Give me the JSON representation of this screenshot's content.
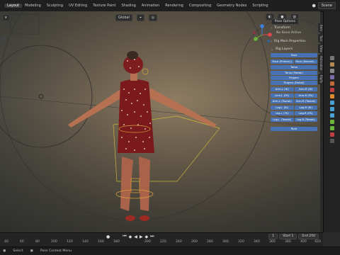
{
  "workspaces": [
    "Layout",
    "Modeling",
    "Sculpting",
    "UV Editing",
    "Texture Paint",
    "Shading",
    "Animation",
    "Rendering",
    "Compositing",
    "Geometry Nodes",
    "Scripting"
  ],
  "active_workspace": "Layout",
  "scene_name": "Scene",
  "header": {
    "transform_orientation": "Global",
    "pose_options": "Pose Options"
  },
  "npanel": {
    "transform_label": "Transform",
    "no_bone_active": "No Bone Active",
    "rig_main_properties": "Rig Main Properties",
    "rig_layers": "Rig Layers",
    "buttons": [
      [
        "Face"
      ],
      [
        "Face (Primary)",
        "Face (Second..."
      ],
      [
        "Torso"
      ],
      [
        "Torso (Tweak)"
      ],
      [
        "Fingers"
      ],
      [
        "Fingers (Detail)"
      ],
      [
        "Arm.L (IK)",
        "Arm.R (IK)"
      ],
      [
        "Arm.L (FK)",
        "Arm.R (FK)"
      ],
      [
        "Arm.L (Tweak)",
        "Arm.R (Tweak)"
      ],
      [
        "Leg.L (IK)",
        "Leg.R (IK)"
      ],
      [
        "Leg.L (FK)",
        "Leg.R (FK)"
      ],
      [
        "Leg.L (Tweak)",
        "Leg.R (Tweak)"
      ]
    ],
    "root_button": "Root"
  },
  "side_tabs": [
    "Item",
    "Tool",
    "View",
    "Animation",
    "Rigify"
  ],
  "timeline": {
    "current_frame": "1",
    "start_label": "Start",
    "start_value": "1",
    "end_label": "End",
    "end_value": "250",
    "ruler": [
      "40",
      "60",
      "80",
      "100",
      "120",
      "140",
      "160",
      "180",
      "200",
      "220",
      "240",
      "260",
      "280",
      "300",
      "320",
      "340",
      "360",
      "380",
      "400",
      "420"
    ]
  },
  "status": {
    "left": "Select",
    "mid": "Pose Context Menu"
  },
  "colors": {
    "accent": "#4772b3",
    "axis_x": "#e0464a",
    "axis_y": "#6cb43a",
    "axis_z": "#3d7ee0"
  }
}
